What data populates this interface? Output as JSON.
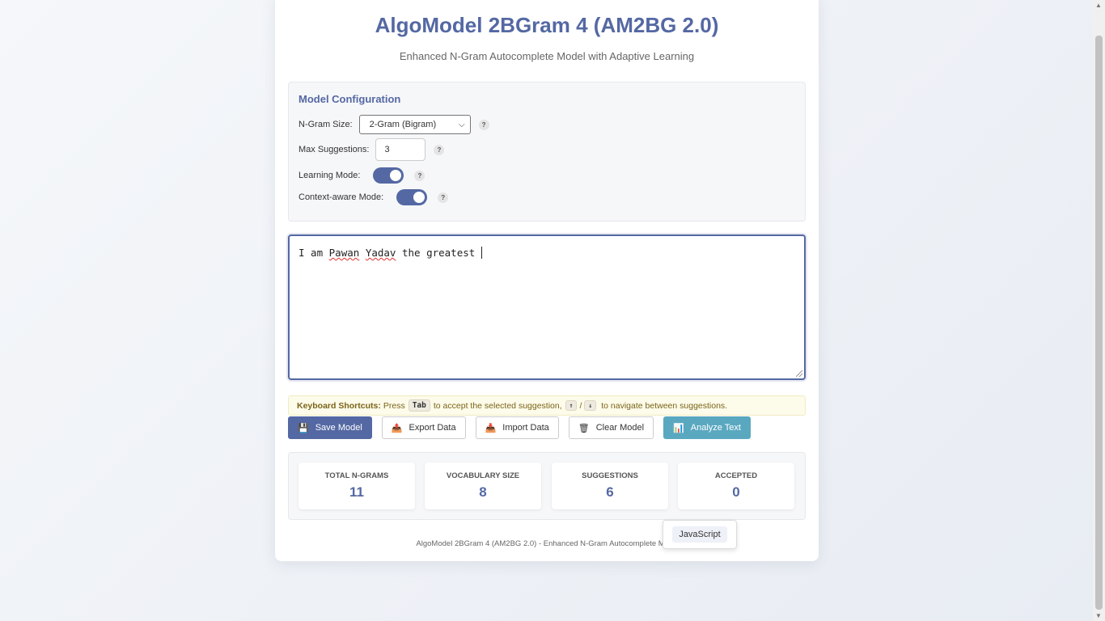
{
  "app": {
    "title": "AlgoModel 2BGram 4 (AM2BG 2.0)",
    "subtitle": "Enhanced N-Gram Autocomplete Model with Adaptive Learning"
  },
  "config": {
    "title": "Model Configuration",
    "ngram_label": "N-Gram Size:",
    "ngram_value": "2-Gram (Bigram)",
    "max_label": "Max Suggestions:",
    "max_value": "3",
    "learning_label": "Learning Mode:",
    "learning_on": true,
    "context_label": "Context-aware Mode:",
    "context_on": true,
    "help_glyph": "?"
  },
  "editor": {
    "word1": "I am ",
    "word2": "Pawan",
    "word3": " ",
    "word4": "Yadav",
    "word5": " the greatest "
  },
  "shortcuts": {
    "heading": "Keyboard Shortcuts:",
    "text1": "Press",
    "key_tab": "Tab",
    "text2": "to accept the selected suggestion,",
    "key_up": "↑",
    "slash": "/",
    "key_down": "↓",
    "text3": "to navigate between suggestions."
  },
  "actions": {
    "save": "Save Model",
    "export": "Export Data",
    "import": "Import Data",
    "clear": "Clear Model",
    "analyze": "Analyze Text"
  },
  "stats": [
    {
      "label": "TOTAL N-GRAMS",
      "value": "11"
    },
    {
      "label": "VOCABULARY SIZE",
      "value": "8"
    },
    {
      "label": "SUGGESTIONS",
      "value": "6"
    },
    {
      "label": "ACCEPTED",
      "value": "0"
    }
  ],
  "footer": "AlgoModel 2BGram 4 (AM2BG 2.0) - Enhanced N-Gram Autocomplete Mode",
  "suggestion_popup": [
    "JavaScript"
  ],
  "colors": {
    "accent": "#5468a3",
    "info": "#5aa8c0",
    "notice_bg": "#fdfbea"
  },
  "icons": {
    "save": "floppy-disk-icon",
    "export": "outbox-tray-icon",
    "import": "inbox-tray-icon",
    "clear": "trash-icon",
    "analyze": "bar-chart-icon"
  }
}
